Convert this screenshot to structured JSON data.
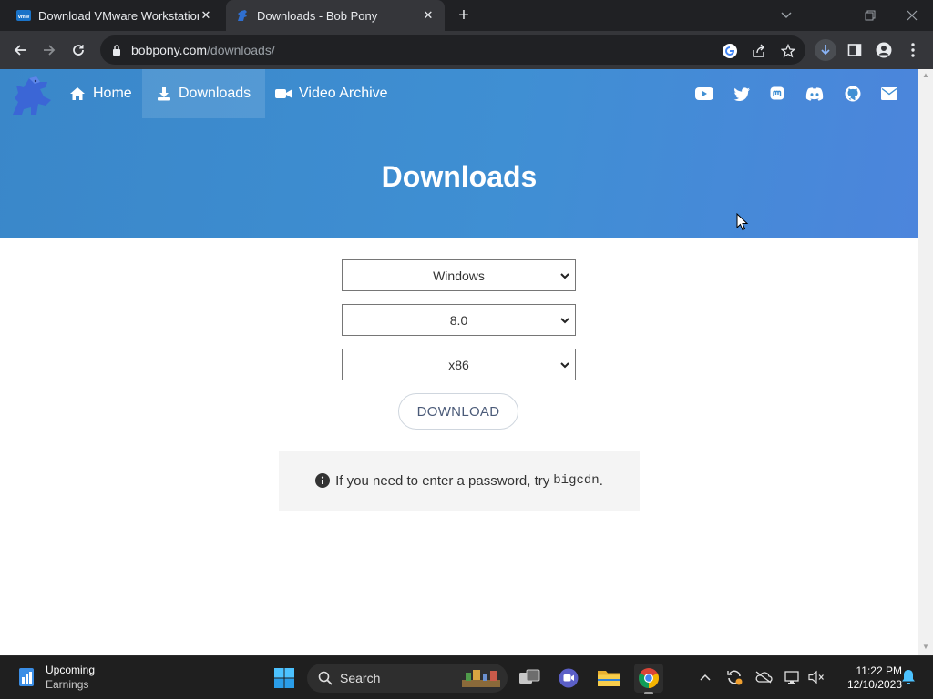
{
  "browser": {
    "tabs": [
      {
        "title": "Download VMware Workstation",
        "active": false,
        "favicon": "vmware-icon"
      },
      {
        "title": "Downloads - Bob Pony",
        "active": true,
        "favicon": "bobpony-icon"
      }
    ],
    "url_host": "bobpony.com",
    "url_path": "/downloads/"
  },
  "site": {
    "nav": [
      {
        "label": "Home",
        "icon": "home-icon"
      },
      {
        "label": "Downloads",
        "icon": "download-icon",
        "active": true
      },
      {
        "label": "Video Archive",
        "icon": "video-camera-icon"
      }
    ],
    "social": [
      "youtube-icon",
      "twitter-icon",
      "mastodon-icon",
      "discord-icon",
      "github-icon",
      "email-icon"
    ],
    "hero_title": "Downloads"
  },
  "form": {
    "os": "Windows",
    "version": "8.0",
    "arch": "x86",
    "download_label": "DOWNLOAD"
  },
  "info": {
    "text": "If you need to enter a password, try",
    "code": "bigcdn",
    "suffix": "."
  },
  "taskbar": {
    "weather_title": "Upcoming",
    "weather_sub": "Earnings",
    "search_label": "Search",
    "time": "11:22 PM",
    "date": "12/10/2023"
  },
  "colors": {
    "hero": "#3f8fd3",
    "page_bg": "#ffffff",
    "taskbar": "#1f1f1f"
  }
}
